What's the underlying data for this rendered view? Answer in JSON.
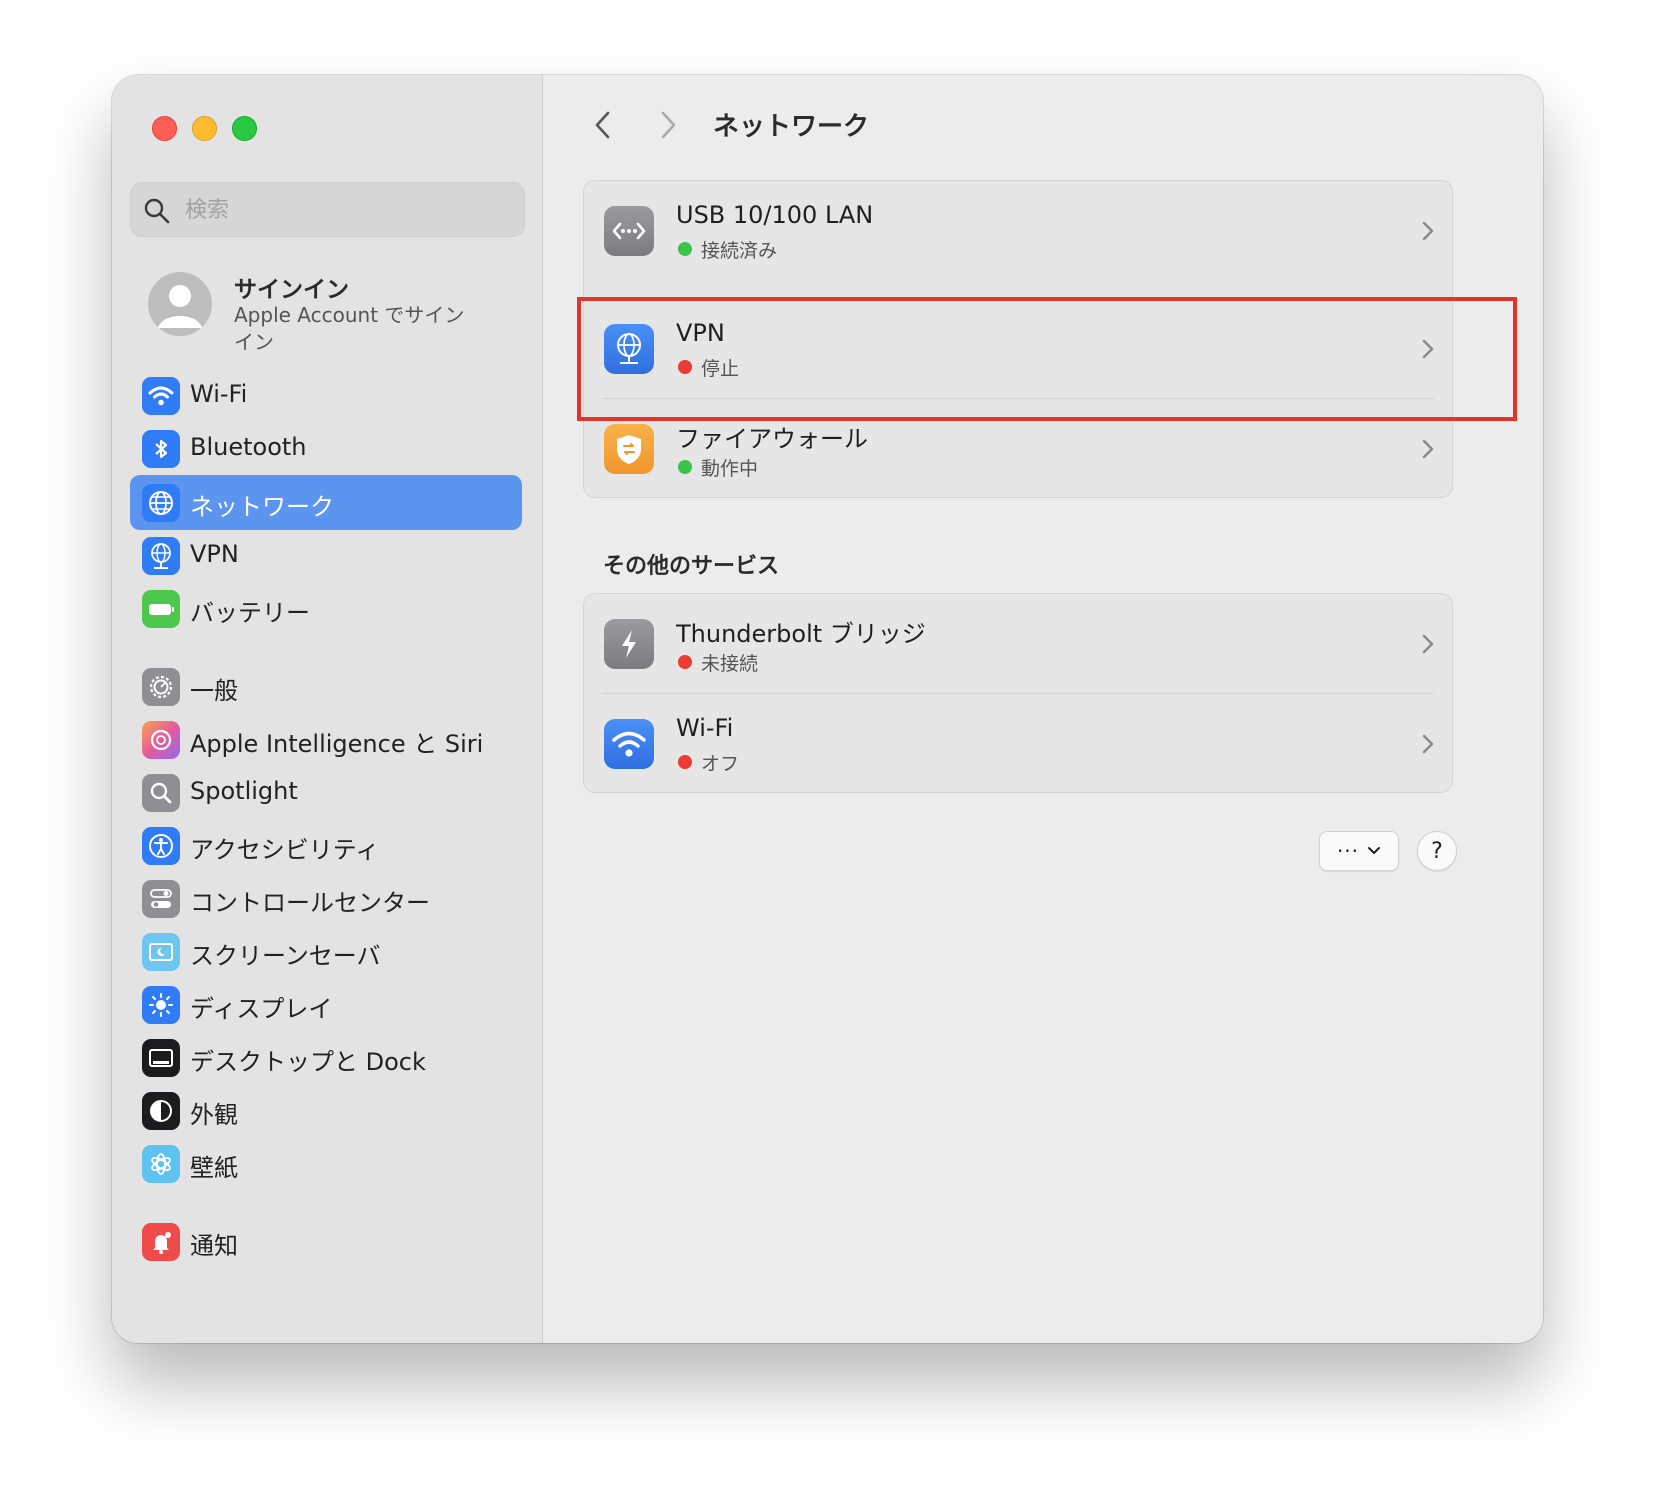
{
  "window": {
    "title": "ネットワーク"
  },
  "search": {
    "placeholder": "検索"
  },
  "account": {
    "name": "サインイン",
    "subtitle": "Apple Account でサインイン"
  },
  "sidebar": {
    "items": [
      {
        "label": "Wi-Fi",
        "icon": "wifi-icon",
        "color": "#2f7cf6"
      },
      {
        "label": "Bluetooth",
        "icon": "bluetooth-icon",
        "color": "#2f7cf6"
      },
      {
        "label": "ネットワーク",
        "icon": "globe-icon",
        "color": "#2f7cf6",
        "selected": true
      },
      {
        "label": "VPN",
        "icon": "vpn-globe-icon",
        "color": "#2f7cf6"
      },
      {
        "label": "バッテリー",
        "icon": "battery-icon",
        "color": "#4cc94c"
      },
      {
        "label": "一般",
        "icon": "gear-icon",
        "color": "#8e8e93"
      },
      {
        "label": "Apple Intelligence と Siri",
        "icon": "apple-intelligence-icon",
        "color": "#e96aa0"
      },
      {
        "label": "Spotlight",
        "icon": "spotlight-search-icon",
        "color": "#8e8e93"
      },
      {
        "label": "アクセシビリティ",
        "icon": "accessibility-icon",
        "color": "#2f7cf6"
      },
      {
        "label": "コントロールセンター",
        "icon": "control-center-icon",
        "color": "#8e8e93"
      },
      {
        "label": "スクリーンセーバ",
        "icon": "screen-saver-icon",
        "color": "#6ec6f0"
      },
      {
        "label": "ディスプレイ",
        "icon": "display-brightness-icon",
        "color": "#2f7cf6"
      },
      {
        "label": "デスクトップと Dock",
        "icon": "desktop-dock-icon",
        "color": "#1c1c1e"
      },
      {
        "label": "外観",
        "icon": "appearance-icon",
        "color": "#1c1c1e"
      },
      {
        "label": "壁紙",
        "icon": "wallpaper-icon",
        "color": "#5ec3f0"
      },
      {
        "label": "通知",
        "icon": "notifications-bell-icon",
        "color": "#ef4b4b"
      }
    ]
  },
  "main": {
    "services": [
      {
        "name": "USB 10/100 LAN",
        "status": "接続済み",
        "status_color": "#3cc34a",
        "icon": "ethernet-icon"
      },
      {
        "name": "VPN",
        "status": "停止",
        "status_color": "#ec3b34",
        "icon": "vpn-globe-icon"
      },
      {
        "name": "ファイアウォール",
        "status": "動作中",
        "status_color": "#3cc34a",
        "icon": "firewall-shield-icon"
      }
    ],
    "other_section_title": "その他のサービス",
    "other_services": [
      {
        "name": "Thunderbolt ブリッジ",
        "status": "未接続",
        "status_color": "#ec3b34",
        "icon": "thunderbolt-icon"
      },
      {
        "name": "Wi-Fi",
        "status": "オフ",
        "status_color": "#ec3b34",
        "icon": "wifi-icon"
      }
    ],
    "more_button": "···",
    "help_button": "?"
  },
  "colors": {
    "highlight": "#e0352b",
    "selected": "#5b95f0"
  }
}
